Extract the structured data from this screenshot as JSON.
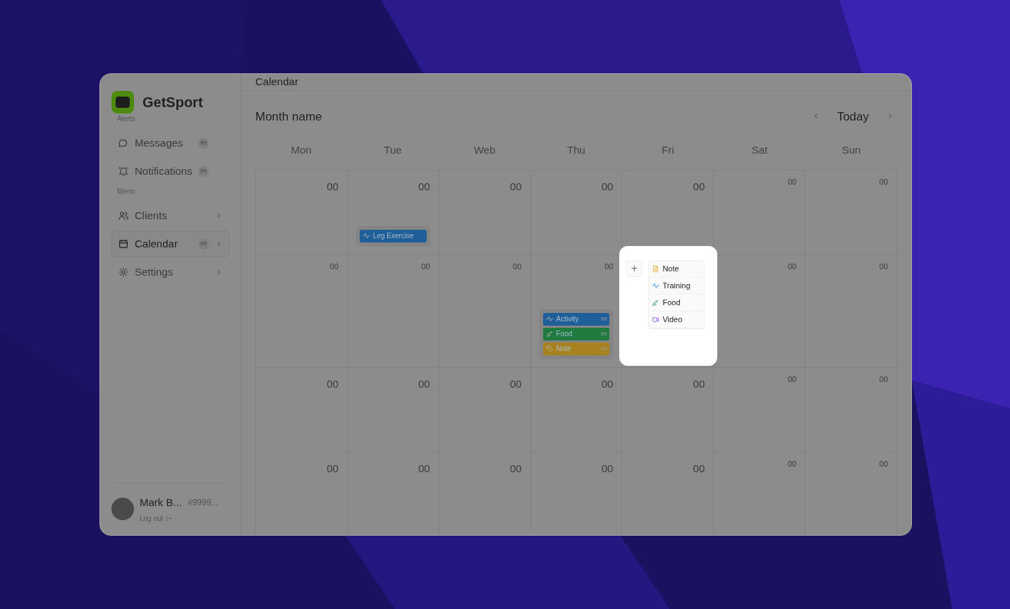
{
  "sidebar": {
    "brand": "GetSport",
    "sections": [
      {
        "title": "Alerts",
        "items": [
          {
            "kind": "chat",
            "label": "Messages",
            "badge": "99",
            "chevron": false,
            "selected": false
          },
          {
            "kind": "bell",
            "label": "Notifications",
            "badge": "99",
            "chevron": false,
            "selected": false
          }
        ]
      },
      {
        "title": "Menu",
        "items": [
          {
            "kind": "users",
            "label": "Clients",
            "chevron": true,
            "selected": false
          },
          {
            "kind": "calendar",
            "label": "Calendar",
            "badge": "99",
            "chevron": true,
            "selected": true
          },
          {
            "kind": "gear",
            "label": "Settings",
            "chevron": true,
            "selected": false
          }
        ]
      }
    ],
    "user": {
      "name": "Mark B...",
      "id": "#9999...",
      "logout": "Log out"
    }
  },
  "header": {
    "title": "Calendar"
  },
  "calendar": {
    "month": "Month name",
    "today": "Today",
    "weekdays": [
      "Mon",
      "Tue",
      "Web",
      "Thu",
      "Fri",
      "Sat",
      "Sun"
    ],
    "weeks": [
      {
        "cells": [
          {
            "date": "00",
            "large": true
          },
          {
            "date": "00",
            "large": true,
            "events": [
              {
                "kind": "activity",
                "label": "Leg Exercise",
                "color": "#1f5f99"
              }
            ]
          },
          {
            "date": "00",
            "large": true
          },
          {
            "date": "00",
            "large": true
          },
          {
            "date": "00",
            "large": true
          },
          {
            "date": "00",
            "large": false
          },
          {
            "date": "00",
            "large": false
          }
        ]
      },
      {
        "cells": [
          {
            "date": "00",
            "large": false
          },
          {
            "date": "00",
            "large": false
          },
          {
            "date": "00",
            "large": false
          },
          {
            "date": "00",
            "large": false,
            "events": [
              {
                "kind": "activity",
                "label": "Activity",
                "count": "99",
                "color": "#1f5f99"
              },
              {
                "kind": "food",
                "label": "Food",
                "count": "99",
                "color": "#1e7a3f"
              },
              {
                "kind": "tag",
                "label": "Note",
                "count": "99",
                "color": "#a8821f"
              }
            ]
          },
          {
            "menu": {
              "add": "+",
              "options": [
                {
                  "kind": "note",
                  "label": "Note"
                },
                {
                  "kind": "activity",
                  "label": "Training"
                },
                {
                  "kind": "food",
                  "label": "Food"
                },
                {
                  "kind": "video",
                  "label": "Video"
                }
              ]
            }
          },
          {
            "date": "00",
            "large": false
          },
          {
            "date": "00",
            "large": false
          }
        ]
      },
      {
        "cells": [
          {
            "date": "00",
            "large": true
          },
          {
            "date": "00",
            "large": true
          },
          {
            "date": "00",
            "large": true
          },
          {
            "date": "00",
            "large": true
          },
          {
            "date": "00",
            "large": true
          },
          {
            "date": "00",
            "large": false
          },
          {
            "date": "00",
            "large": false
          }
        ]
      },
      {
        "cells": [
          {
            "date": "00",
            "large": true
          },
          {
            "date": "00",
            "large": true
          },
          {
            "date": "00",
            "large": true
          },
          {
            "date": "00",
            "large": true
          },
          {
            "date": "00",
            "large": true
          },
          {
            "date": "00",
            "large": false
          },
          {
            "date": "00",
            "large": false
          }
        ]
      }
    ]
  }
}
